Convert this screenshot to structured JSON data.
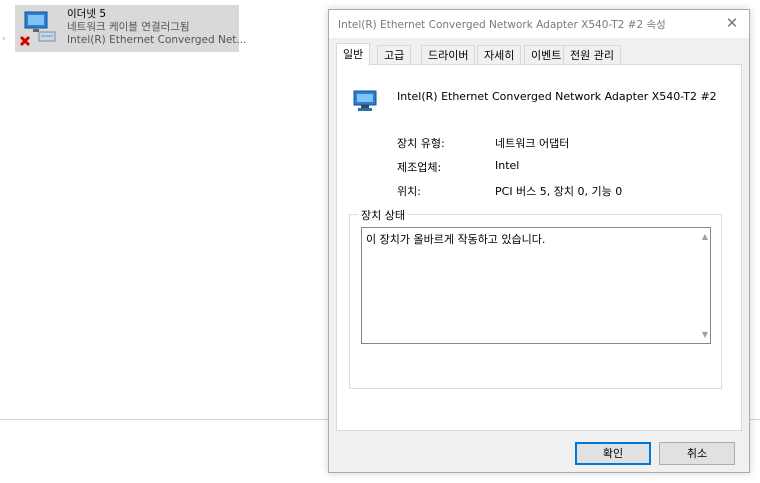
{
  "background": {
    "connection": {
      "name": "이더넷 5",
      "status": "네트워크 케이블 연결러그됨",
      "adapter": "Intel(R) Ethernet Converged Net..."
    }
  },
  "dialog": {
    "title": "Intel(R) Ethernet Converged Network Adapter X540-T2 #2 속성",
    "close_glyph": "✕",
    "tabs": [
      "일반",
      "고급",
      "드라이버",
      "자세히",
      "이벤트",
      "전원 관리"
    ],
    "active_tab": "일반",
    "device_name": "Intel(R) Ethernet Converged Network Adapter X540-T2 #2",
    "properties": [
      {
        "label": "장치 유형:",
        "value": "네트워크 어댑터"
      },
      {
        "label": "제조업체:",
        "value": "Intel"
      },
      {
        "label": "위치:",
        "value": "PCI 버스 5, 장치 0, 기능 0"
      }
    ],
    "status_group": {
      "legend": "장치 상태",
      "text": "이 장치가 올바르게 작동하고 있습니다."
    },
    "buttons": {
      "ok": "확인",
      "cancel": "취소"
    }
  },
  "colors": {
    "accent": "#0078d7",
    "selection": "#d9d9d9",
    "dialog_bg": "#f0f0f0"
  },
  "icons": [
    "network-adapter-icon",
    "disconnected-x-icon",
    "close-icon",
    "scroll-up-icon",
    "scroll-down-icon"
  ]
}
